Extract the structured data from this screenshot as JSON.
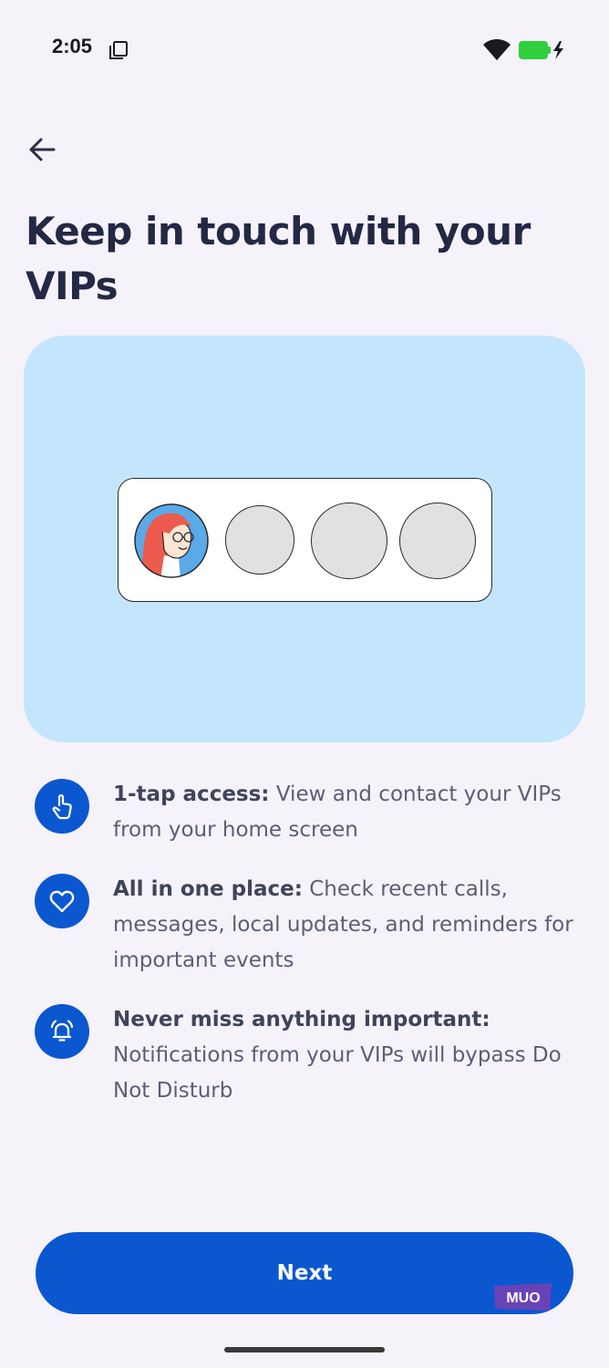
{
  "status_bar": {
    "time": "2:05",
    "icons": [
      "screenshot-icon",
      "wifi-icon",
      "battery-charging-icon"
    ],
    "battery_color": "#2fcf3d"
  },
  "header": {
    "back_icon": "arrow-back-icon",
    "title": "Keep in touch with your VIPs"
  },
  "hero": {
    "background": "#c3e6fd",
    "vip_slots": 4
  },
  "features": [
    {
      "icon": "tap-finger-icon",
      "title": "1-tap access:",
      "text": " View and contact your VIPs from your home screen"
    },
    {
      "icon": "heart-icon",
      "title": "All in one place:",
      "text": " Check recent calls, messages, local updates, and reminders for important events"
    },
    {
      "icon": "alarm-bell-icon",
      "title": "Never miss anything important:",
      "text": " Notifications from your VIPs will bypass Do Not Disturb"
    }
  ],
  "next_button": {
    "label": "Next",
    "color": "#0b57d0"
  },
  "watermark": {
    "text": "MUO"
  }
}
